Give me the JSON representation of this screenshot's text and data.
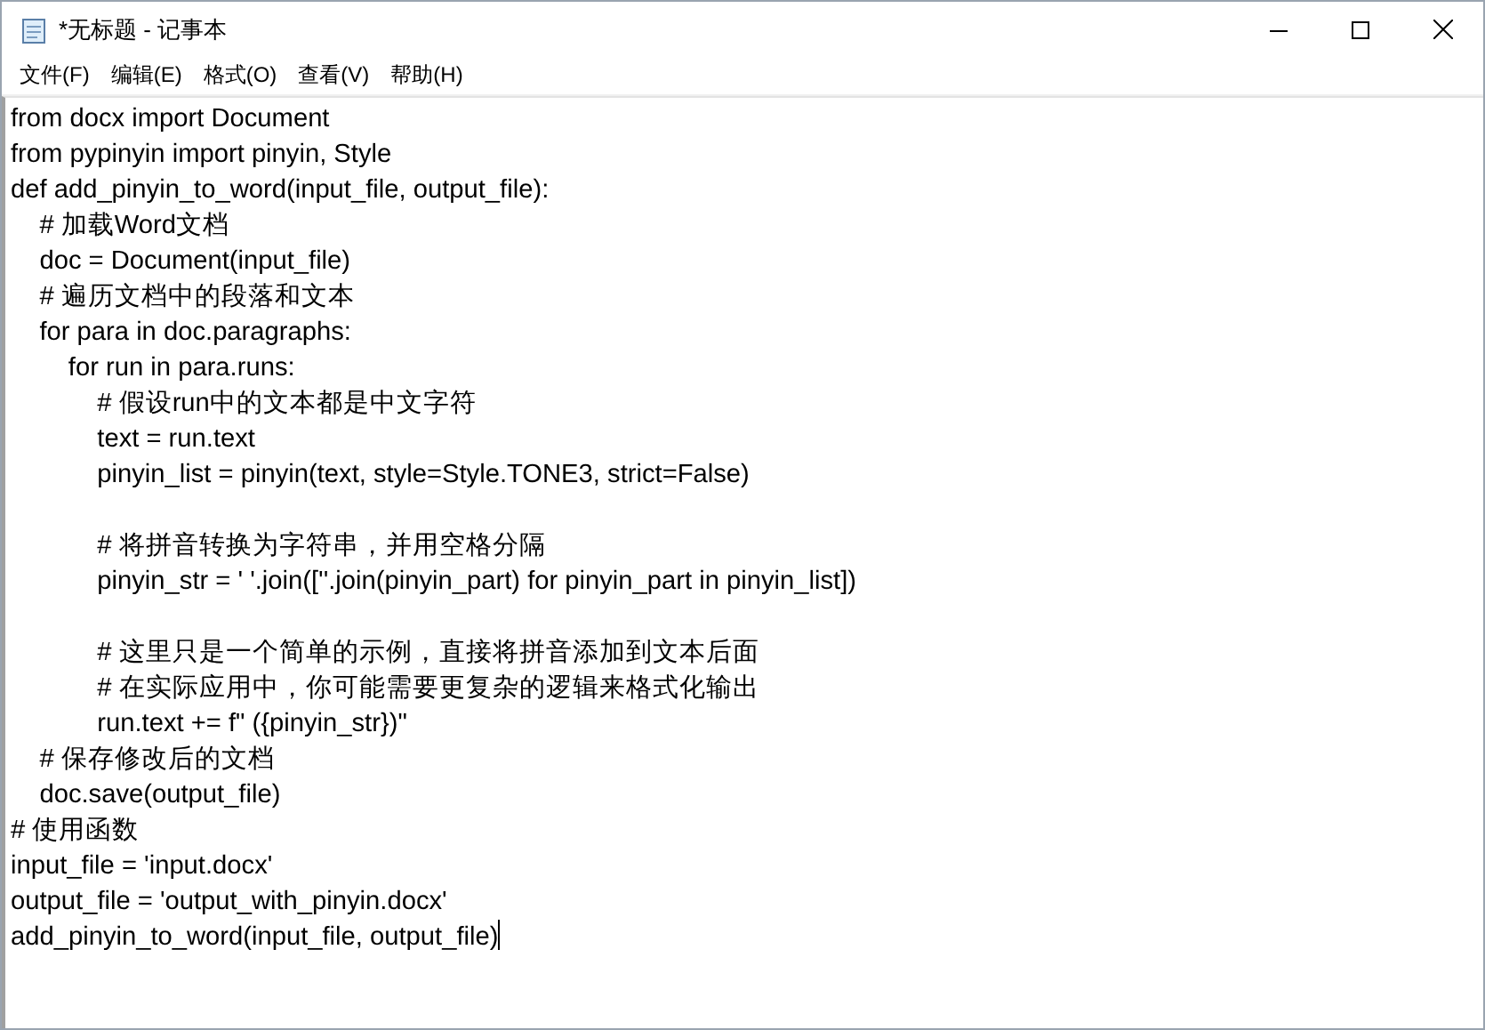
{
  "window": {
    "title": "*无标题 - 记事本"
  },
  "menu": [
    "文件(F)",
    "编辑(E)",
    "格式(O)",
    "查看(V)",
    "帮助(H)"
  ],
  "editor": {
    "text": "from docx import Document\nfrom pypinyin import pinyin, Style\ndef add_pinyin_to_word(input_file, output_file):\n    # 加载Word文档\n    doc = Document(input_file)\n    # 遍历文档中的段落和文本\n    for para in doc.paragraphs:\n        for run in para.runs:\n            # 假设run中的文本都是中文字符\n            text = run.text\n            pinyin_list = pinyin(text, style=Style.TONE3, strict=False)\n\n            # 将拼音转换为字符串，并用空格分隔\n            pinyin_str = ' '.join([''.join(pinyin_part) for pinyin_part in pinyin_list])\n\n            # 这里只是一个简单的示例，直接将拼音添加到文本后面\n            # 在实际应用中，你可能需要更复杂的逻辑来格式化输出\n            run.text += f\" ({pinyin_str})\"\n    # 保存修改后的文档\n    doc.save(output_file)\n# 使用函数\ninput_file = 'input.docx'\noutput_file = 'output_with_pinyin.docx'\nadd_pinyin_to_word(input_file, output_file)",
    "caret": true
  }
}
